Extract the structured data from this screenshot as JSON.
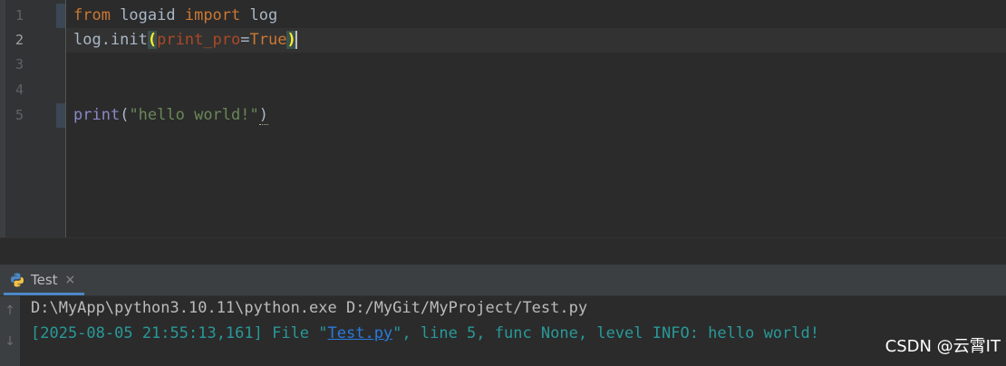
{
  "editor": {
    "line_numbers": [
      "1",
      "2",
      "3",
      "4",
      "5"
    ],
    "lines": [
      {
        "from_kw": "from",
        "module": " logaid ",
        "import_kw": "import",
        "name": " log"
      },
      {
        "prefix": "log.init",
        "open": "(",
        "param": "print_pro",
        "eq": "=",
        "value": "True",
        "close": ")"
      },
      {},
      {},
      {
        "func": "print",
        "open": "(",
        "string": "\"hello world!\"",
        "close": ")"
      }
    ]
  },
  "tool_window": {
    "tab_label": "Test",
    "close_glyph": "×",
    "icons": {
      "tab": "python-icon",
      "rerun": "up-arrow-icon",
      "stop": "down-arrow-icon"
    }
  },
  "console": {
    "command": "D:\\MyApp\\python3.10.11\\python.exe D:/MyGit/MyProject/Test.py",
    "log_prefix": "[2025-08-05 21:55:13,161] File \"",
    "log_link": "Test.py",
    "log_suffix": "\", line 5, func None, level INFO: hello world!"
  },
  "watermark": "CSDN @云霄IT",
  "colors": {
    "background": "#2b2b2b",
    "keyword": "#cc7832",
    "string": "#6a8759",
    "param": "#aa4926",
    "log_text": "#299999",
    "link": "#287bde"
  }
}
